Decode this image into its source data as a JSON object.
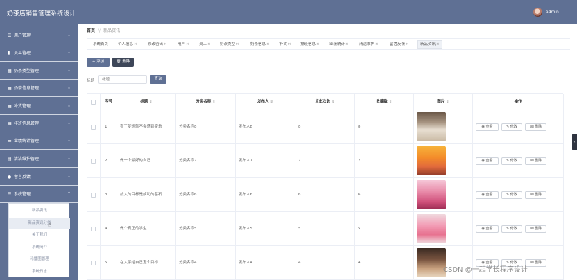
{
  "header": {
    "app_title": "奶茶店销售管理系统设计",
    "user_name": "admin"
  },
  "sidebar": {
    "items": [
      {
        "icon": "users-icon",
        "glyph": "☰",
        "label": "用户管理"
      },
      {
        "icon": "bar-chart-icon",
        "glyph": "▮",
        "label": "员工管理"
      },
      {
        "icon": "grid-icon",
        "glyph": "▦",
        "label": "奶茶类型管理"
      },
      {
        "icon": "grid-icon",
        "glyph": "▦",
        "label": "奶茶信息管理"
      },
      {
        "icon": "grid-icon",
        "glyph": "▦",
        "label": "补货管理"
      },
      {
        "icon": "grid-icon",
        "glyph": "▦",
        "label": "排班信息管理"
      },
      {
        "icon": "card-icon",
        "glyph": "▬",
        "label": "业绩统计管理"
      },
      {
        "icon": "document-icon",
        "glyph": "▤",
        "label": "清洁维护管理"
      },
      {
        "icon": "person-icon",
        "glyph": "●",
        "label": "留言反馈"
      },
      {
        "icon": "list-icon",
        "glyph": "☰",
        "label": "系统管理"
      }
    ],
    "submenu": [
      "新品资讯",
      "新品资讯分类",
      "关于我们",
      "系统简介",
      "轮播图管理",
      "系统日志"
    ]
  },
  "breadcrumb": {
    "home": "首页",
    "separator": "//",
    "current": "新品资讯"
  },
  "tabs": [
    {
      "label": "系统首页",
      "closable": false
    },
    {
      "label": "个人信息",
      "closable": true
    },
    {
      "label": "修改密码",
      "closable": true
    },
    {
      "label": "用户",
      "closable": true
    },
    {
      "label": "员工",
      "closable": true
    },
    {
      "label": "奶茶类型",
      "closable": true
    },
    {
      "label": "奶茶信息",
      "closable": true
    },
    {
      "label": "补货",
      "closable": true
    },
    {
      "label": "排班信息",
      "closable": true
    },
    {
      "label": "业绩统计",
      "closable": true
    },
    {
      "label": "清洁维护",
      "closable": true
    },
    {
      "label": "留言反馈",
      "closable": true
    },
    {
      "label": "新品资讯",
      "closable": true
    }
  ],
  "toolbar": {
    "add_label": "+ 添加",
    "delete_label": "删除"
  },
  "search": {
    "label": "标题",
    "placeholder": "标题",
    "button_label": "查询"
  },
  "table": {
    "columns": [
      "序号",
      "标题",
      "分类名称",
      "发布人",
      "点击次数",
      "收藏数",
      "图片",
      "操作"
    ],
    "sortable": [
      false,
      true,
      true,
      true,
      true,
      true,
      true,
      false
    ],
    "rows": [
      {
        "index": "1",
        "title": "有了梦想就不会感到疲惫",
        "category": "分类名称8",
        "publisher": "发布人8",
        "clicks": "8",
        "favorites": "8",
        "image": "latte"
      },
      {
        "index": "2",
        "title": "做一个最好的自己",
        "category": "分类名称7",
        "publisher": "发布人7",
        "clicks": "7",
        "favorites": "7",
        "image": "mango"
      },
      {
        "index": "3",
        "title": "战大的目标是成功的基石",
        "category": "分类名称6",
        "publisher": "发布人6",
        "clicks": "6",
        "favorites": "6",
        "image": "berry"
      },
      {
        "index": "4",
        "title": "做个真正的学生",
        "category": "分类名称5",
        "publisher": "发布人5",
        "clicks": "5",
        "favorites": "5",
        "image": "pink"
      },
      {
        "index": "5",
        "title": "在大学给自己定个目标",
        "category": "分类名称4",
        "publisher": "发布人4",
        "clicks": "4",
        "favorites": "4",
        "image": "coffee"
      }
    ],
    "actions": [
      "查看",
      "修改",
      "删除"
    ]
  },
  "watermark": "CSDN @一起学长程序设计",
  "colors": {
    "primary": "#5f7094",
    "dark_button": "#3d4658",
    "border": "#ebeef5"
  }
}
